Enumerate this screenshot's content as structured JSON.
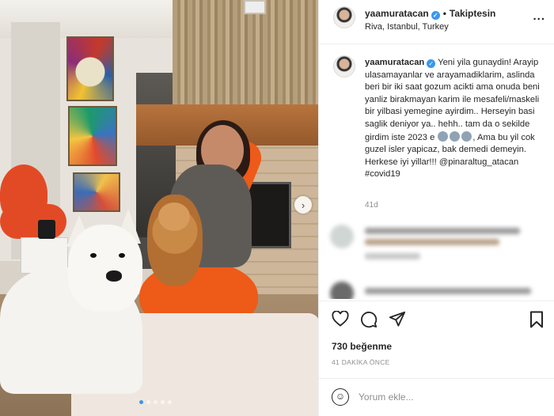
{
  "post": {
    "username": "yaamuratacan",
    "follow_label": "Takiptesin",
    "separator": "•",
    "location": "Riva, Istanbul, Turkey",
    "more_label": "...",
    "verified_mark": "✓",
    "next_icon": "›",
    "carousel": {
      "slides": 5,
      "active": 1
    }
  },
  "caption": {
    "username": "yaamuratacan",
    "text_part1": " Yeni yila gunaydin! Arayip ulasamayanlar ve arayamadiklarim, aslinda beri bir iki saat gozum acikti ama onuda beni yanliz birakmayan karim ile mesafeli/maskeli bir yilbasi yemegine ayirdim.. Herseyin basi saglik deniyor ya.. hehh.. tam da o sekilde girdim iste 2023 e ",
    "text_part2": ", Ama bu yil cok guzel isler yapicaz, bak demedi demeyin. Herkese iyi yillar!!! @pinaraltug_atacan #covid19",
    "time": "41d"
  },
  "actions": {
    "like_icon": "heart-icon",
    "comment_icon": "comment-icon",
    "share_icon": "share-icon",
    "save_icon": "bookmark-icon"
  },
  "likes": "730 beğenme",
  "time_ago": "41 DAKİKA ÖNCE",
  "comment_box": {
    "emoji_icon": "☺",
    "placeholder": "Yorum ekle..."
  },
  "colors": {
    "verified": "#3897f0",
    "text": "#262626",
    "muted": "#8e8e8e",
    "border": "#efefef"
  }
}
